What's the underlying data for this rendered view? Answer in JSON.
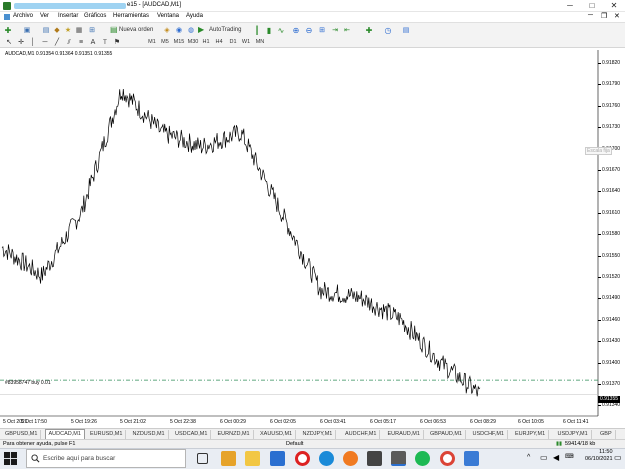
{
  "window": {
    "title": "e15 - [AUDCAD,M1]",
    "controls": [
      "─",
      "□",
      "✕"
    ]
  },
  "menu": [
    "Archivo",
    "Ver",
    "Insertar",
    "Gráficos",
    "Herramientas",
    "Ventana",
    "Ayuda"
  ],
  "toolbar": {
    "new_order": "Nueva orden",
    "autotrading": "AutoTrading",
    "timeframes": [
      "M1",
      "M5",
      "M15",
      "M30",
      "H1",
      "H4",
      "D1",
      "W1",
      "MN"
    ]
  },
  "chart": {
    "header": "AUDCAD,M1  0.91354 0.91364 0.91351 0.91355",
    "escala_fija": "Escala fija",
    "order_label": "#83958747 buy 0.01",
    "current_price": "0.91355",
    "price_labels": [
      "0.91820",
      "0.91790",
      "0.91760",
      "0.91730",
      "0.91700",
      "0.91670",
      "0.91640",
      "0.91610",
      "0.91580",
      "0.91550",
      "0.91520",
      "0.91490",
      "0.91460",
      "0.91430",
      "0.91400",
      "0.91370",
      "0.91340"
    ],
    "time_labels": [
      "5 Oct 2021",
      "5 Oct 17:50",
      "5 Oct 19:26",
      "5 Oct 21:02",
      "5 Oct 22:38",
      "6 Oct 00:29",
      "6 Oct 02:05",
      "6 Oct 03:41",
      "6 Oct 05:17",
      "6 Oct 06:53",
      "6 Oct 08:29",
      "6 Oct 10:05",
      "6 Oct 11:41"
    ]
  },
  "chart_data": {
    "type": "line",
    "symbol": "AUDCAD",
    "timeframe": "M1",
    "ylim": [
      0.91325,
      0.91835
    ],
    "order_level": 0.91375,
    "x": [
      "5 Oct 2021",
      "5 Oct 17:50",
      "5 Oct 19:26",
      "5 Oct 21:02",
      "5 Oct 22:38",
      "6 Oct 00:29",
      "6 Oct 02:05",
      "6 Oct 03:41",
      "6 Oct 05:17",
      "6 Oct 06:53",
      "6 Oct 08:29",
      "6 Oct 10:05",
      "6 Oct 11:41"
    ],
    "values": [
      0.9156,
      0.9152,
      0.9161,
      0.9178,
      0.9172,
      0.917,
      0.9172,
      0.9161,
      0.915,
      0.9149,
      0.9146,
      0.914,
      0.91355
    ]
  },
  "tabs": [
    "GBPUSD,M1",
    "AUDCAD,M1",
    "EURUSD,M1",
    "NZDUSD,M1",
    "USDCAD,M1",
    "EURNZD,M1",
    "XAUUSD,M1",
    "NZDJPY,M1",
    "AUDCHF,M1",
    "EURAUD,M1",
    "GBPAUD,M1",
    "USDCHF,M1",
    "EURJPY,M1",
    "USDJPY,M1",
    "GBP"
  ],
  "active_tab": "AUDCAD,M1",
  "status": {
    "help": "Para obtener ayuda, pulse F1",
    "profile": "Default",
    "traffic": "59414/18 kb"
  },
  "taskbar": {
    "search_placeholder": "Escribe aquí para buscar",
    "time": "11:50",
    "date": "06/10/2021"
  }
}
